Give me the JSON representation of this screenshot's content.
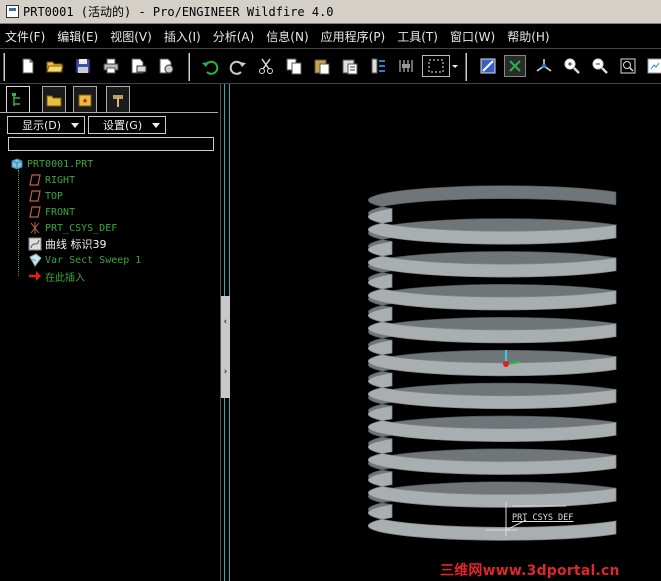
{
  "window": {
    "title": "PRT0001 (活动的) - Pro/ENGINEER Wildfire 4.0"
  },
  "menu": [
    "文件(F)",
    "编辑(E)",
    "视图(V)",
    "插入(I)",
    "分析(A)",
    "信息(N)",
    "应用程序(P)",
    "工具(T)",
    "窗口(W)",
    "帮助(H)"
  ],
  "toolbar": {
    "icons": [
      "new-file-icon",
      "open-folder-icon",
      "save-icon",
      "print-icon",
      "send-mail-icon",
      "save-copy-icon",
      "undo-icon",
      "redo-icon",
      "cut-icon",
      "copy-icon",
      "paste-icon",
      "paste-special-icon",
      "regenerate-icon",
      "named-view-icon",
      "select-box-icon",
      "repaint-icon",
      "spin-center-icon",
      "orient-icon",
      "zoom-in-icon",
      "zoom-out-icon",
      "refit-icon",
      "view-list-icon"
    ]
  },
  "left_panel": {
    "tabs": [
      "model-tree-tab",
      "folder-browser-tab",
      "favorites-tab",
      "connections-tab"
    ],
    "display_dropdown": "显示(D)",
    "settings_dropdown": "设置(G)",
    "search_value": "",
    "tree": [
      {
        "label": "PRT0001.PRT",
        "icon": "part-icon",
        "color": "#3aa83a"
      },
      {
        "label": "RIGHT",
        "icon": "datum-plane-icon",
        "color": "#3aa83a"
      },
      {
        "label": "TOP",
        "icon": "datum-plane-icon",
        "color": "#3aa83a"
      },
      {
        "label": "FRONT",
        "icon": "datum-plane-icon",
        "color": "#3aa83a"
      },
      {
        "label": "PRT_CSYS_DEF",
        "icon": "csys-icon",
        "color": "#3aa83a"
      },
      {
        "label": "曲线 标识39",
        "icon": "curve-icon",
        "color": "#f0f0f0"
      },
      {
        "label": "Var Sect Sweep 1",
        "icon": "sweep-icon",
        "color": "#3aa83a"
      },
      {
        "label": "在此插入",
        "icon": "insert-here-arrow-icon",
        "color": "#3aa83a"
      }
    ]
  },
  "viewport": {
    "csys_label": "PRT_CSYS_DEF",
    "coil_turns": 10,
    "spring_color": "#a9aeb1"
  },
  "watermark": "三维网www.3dportal.cn"
}
